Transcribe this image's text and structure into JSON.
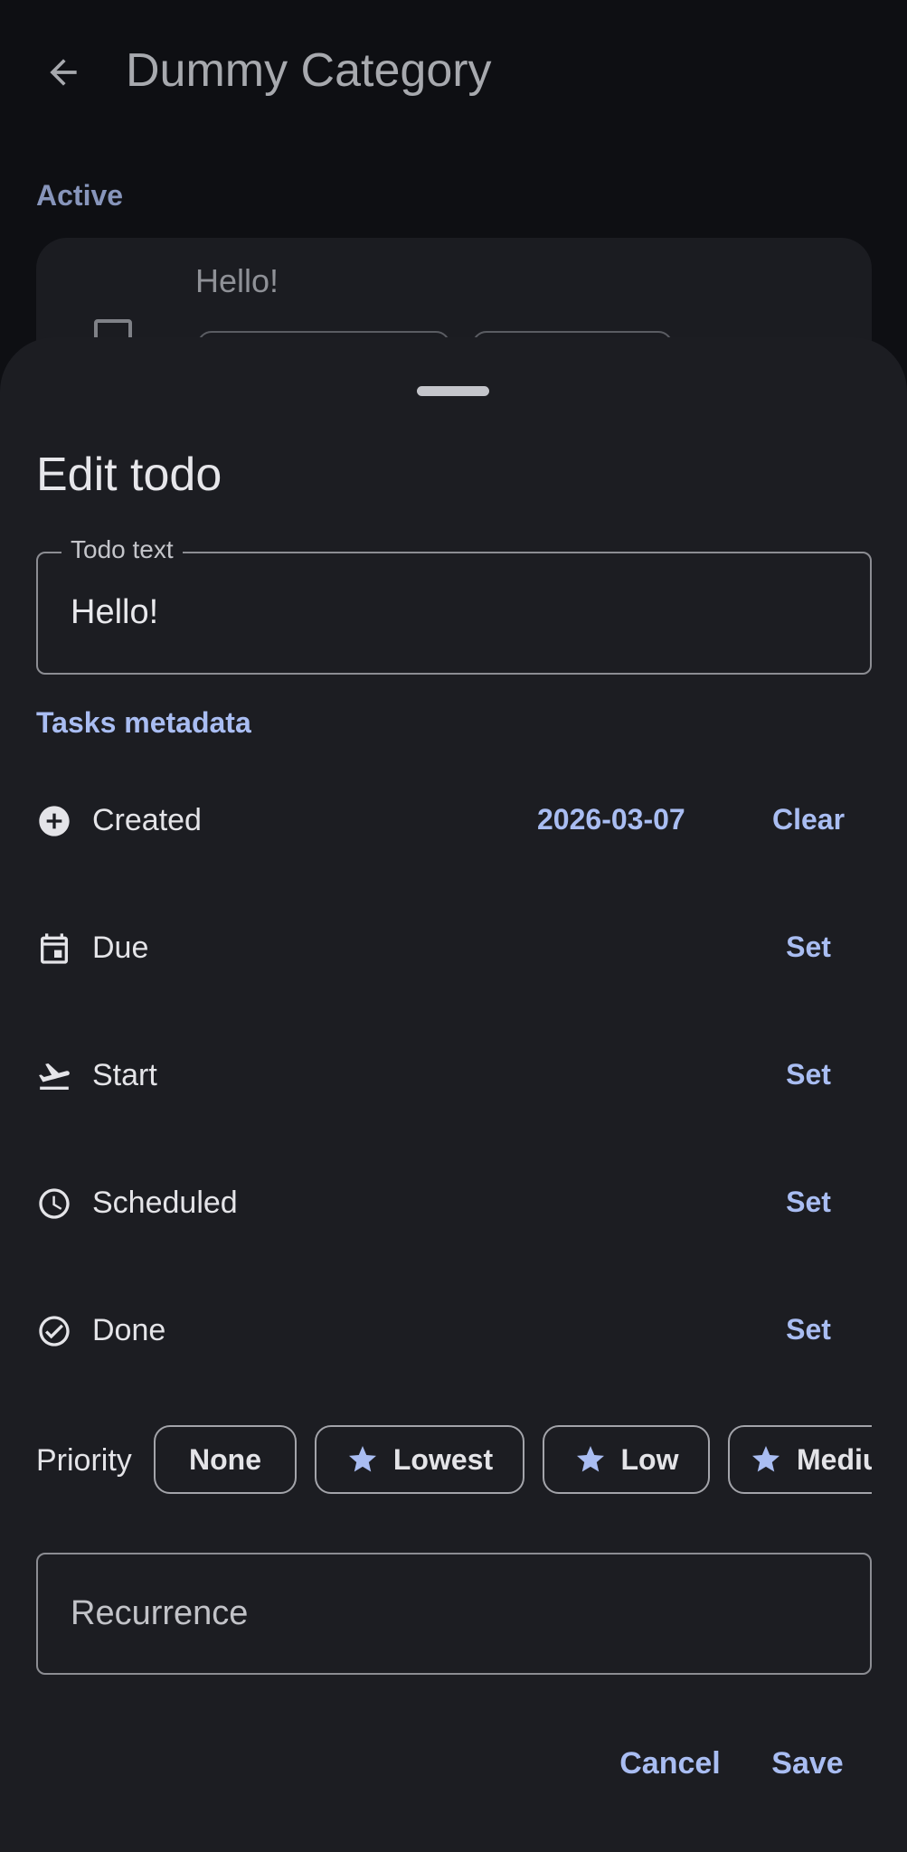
{
  "appbar": {
    "title": "Dummy Category",
    "back_icon": "arrow-back-icon"
  },
  "background": {
    "section_label": "Active",
    "todo_text": "Hello!"
  },
  "sheet": {
    "title": "Edit todo",
    "todo_field": {
      "label": "Todo text",
      "value": "Hello!"
    },
    "metadata_heading": "Tasks metadata",
    "metadata_rows": [
      {
        "label": "Created",
        "value": "2026-03-07",
        "action": "Clear",
        "icon": "add-circle-icon"
      },
      {
        "label": "Due",
        "value": "",
        "action": "Set",
        "icon": "calendar-icon"
      },
      {
        "label": "Start",
        "value": "",
        "action": "Set",
        "icon": "flight-takeoff-icon"
      },
      {
        "label": "Scheduled",
        "value": "",
        "action": "Set",
        "icon": "clock-icon"
      },
      {
        "label": "Done",
        "value": "",
        "action": "Set",
        "icon": "check-circle-icon"
      }
    ],
    "priority": {
      "label": "Priority",
      "options": [
        {
          "label": "None",
          "icon": ""
        },
        {
          "label": "Lowest",
          "icon": "star-icon"
        },
        {
          "label": "Low",
          "icon": "star-icon"
        },
        {
          "label": "Medium",
          "icon": "star-icon"
        }
      ]
    },
    "recurrence": {
      "placeholder": "Recurrence"
    },
    "buttons": {
      "cancel": "Cancel",
      "save": "Save"
    }
  },
  "colors": {
    "accent": "#a9bdf2",
    "sheet_background": "#1c1d22",
    "screen_background": "#0e0f13",
    "outline": "#8c8d93"
  }
}
